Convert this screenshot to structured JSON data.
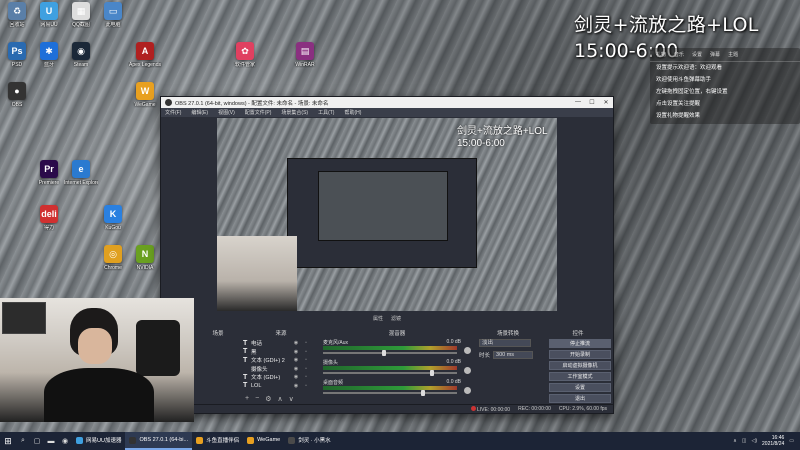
{
  "overlay": {
    "title": "剑灵+流放之路+LOL",
    "time": "15:00-6:00"
  },
  "chat": {
    "toolbar": [
      "礼物",
      "音乐",
      "设置",
      "弹幕",
      "主题"
    ],
    "messages": [
      "设置提示欢迎语：欢迎观看",
      "欢迎使用斗鱼弹幕助手",
      "左键拖拽固定位置，右键设置",
      "点击设置关注提醒",
      "设置礼物提醒效果"
    ]
  },
  "desktop_icons": [
    {
      "label": "回收站",
      "color": "#5a7fa8",
      "glyph": "♻"
    },
    {
      "label": "网易UU",
      "color": "#3fa0e0",
      "glyph": "U"
    },
    {
      "label": "QQ截图",
      "color": "#ddd",
      "glyph": "▦"
    },
    {
      "label": "此电脑",
      "color": "#4a86c8",
      "glyph": "▭"
    },
    {
      "label": "PSD",
      "color": "#2a6ab0",
      "glyph": "Ps"
    },
    {
      "label": "蓝牙",
      "color": "#1e6fd9",
      "glyph": "✱"
    },
    {
      "label": "Steam",
      "color": "#1b2838",
      "glyph": "◉"
    },
    {
      "label": "Apex Legends",
      "color": "#b02020",
      "glyph": "A"
    },
    {
      "label": "OBS",
      "color": "#333",
      "glyph": "●"
    },
    {
      "label": "WeGame",
      "color": "#e8a020",
      "glyph": "W"
    },
    {
      "label": "Premiere",
      "color": "#2a0a4a",
      "glyph": "Pr"
    },
    {
      "label": "Internet Explorer",
      "color": "#2a7ad0",
      "glyph": "e"
    },
    {
      "label": "得力",
      "color": "#d03030",
      "glyph": "deli"
    },
    {
      "label": "KuGou",
      "color": "#2a80e0",
      "glyph": "K"
    },
    {
      "label": "Chrome",
      "color": "#e0a020",
      "glyph": "◎"
    },
    {
      "label": "NVIDIA",
      "color": "#6aa020",
      "glyph": "N"
    },
    {
      "label": "WinRAR",
      "color": "#8a3080",
      "glyph": "▤"
    },
    {
      "label": "软件管家",
      "color": "#e04060",
      "glyph": "✿"
    }
  ],
  "obs": {
    "window_title": "OBS 27.0.1 (64-bit, windows) - 配置文件: 未命名 - 场景: 未命名",
    "menu": [
      "文件(F)",
      "编辑(E)",
      "视图(V)",
      "配置文件(P)",
      "场景集合(S)",
      "工具(T)",
      "帮助(H)"
    ],
    "scene_toggles": [
      "属性",
      "滤镜"
    ],
    "dock_headers": [
      "场景",
      "来源",
      "混音器",
      "场景转换",
      "控件"
    ],
    "sources": [
      {
        "type": "T",
        "name": "电话"
      },
      {
        "type": "T",
        "name": "黑"
      },
      {
        "type": "T",
        "name": "文本 (GDI+) 2"
      },
      {
        "type": "",
        "name": "摄像头"
      },
      {
        "type": "T",
        "name": "文本 (GDI+)"
      },
      {
        "type": "T",
        "name": "LOL"
      }
    ],
    "mixer": [
      {
        "name": "麦克风/Aux",
        "db": "0.0 dB",
        "level": 0.45
      },
      {
        "name": "摄像头",
        "db": "0.0 dB",
        "level": 0.82
      },
      {
        "name": "桌面音频",
        "db": "0.0 dB",
        "level": 0.75
      }
    ],
    "transition": {
      "selected": "淡出",
      "duration_label": "时长",
      "duration": "300 ms"
    },
    "controls": [
      {
        "label": "停止推流",
        "active": true
      },
      {
        "label": "开始录制",
        "active": false
      },
      {
        "label": "启动虚拟摄像机",
        "active": false
      },
      {
        "label": "工作室模式",
        "active": false
      },
      {
        "label": "设置",
        "active": false
      },
      {
        "label": "退出",
        "active": false
      }
    ],
    "status": {
      "live": "LIVE: 00:00:00",
      "rec": "REC: 00:00:00",
      "cpu": "CPU: 2.9%, 60.00 fps"
    },
    "preview_title": "剑灵+流放之路+LOL",
    "preview_time": "15:00-6:00"
  },
  "taskbar": {
    "apps": [
      {
        "label": "网易UU加速器",
        "color": "#3fa0e0",
        "active": false
      },
      {
        "label": "OBS 27.0.1 (64-bi...",
        "color": "#333",
        "active": true
      },
      {
        "label": "斗鱼直播伴侣",
        "color": "#e8a020",
        "active": false
      },
      {
        "label": "WeGame",
        "color": "#e8a020",
        "active": false
      },
      {
        "label": "剑灵 · 小黑水",
        "color": "#4a4a4a",
        "active": false
      }
    ],
    "clock_time": "16:46",
    "clock_date": "2021/8/24"
  }
}
